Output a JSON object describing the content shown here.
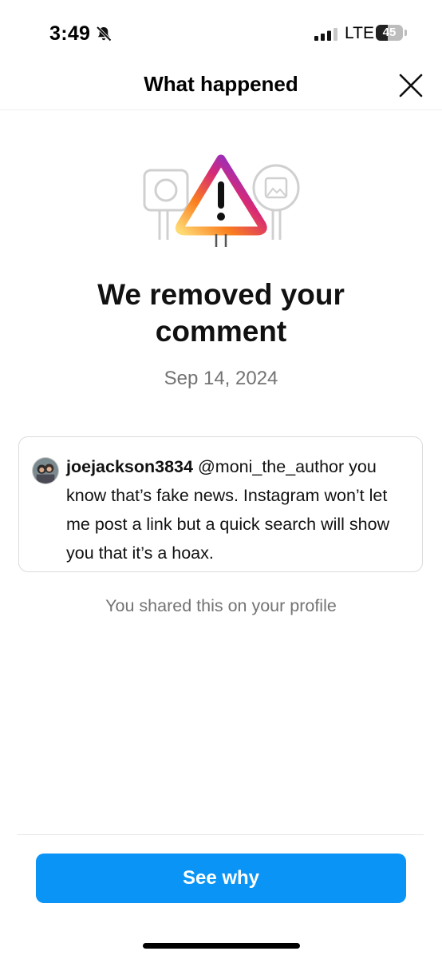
{
  "status_bar": {
    "time": "3:49",
    "network": "LTE",
    "battery_level": "45",
    "icons": [
      "bell-slash-icon",
      "cellular-signal-icon",
      "battery-icon"
    ]
  },
  "header": {
    "title": "What happened",
    "close_icon": "close-icon"
  },
  "illustration": {
    "icon": "warning-triangle-icon",
    "gradient_colors": [
      "#feda75",
      "#fa7e1e",
      "#d62976",
      "#962fbf",
      "#4f5bd5"
    ]
  },
  "main": {
    "headline": "We removed your comment",
    "date": "Sep 14, 2024"
  },
  "comment": {
    "username": "joejackson3834",
    "text": "@moni_the_author you know that’s fake news. Instagram won’t let me post a link but a quick search will show you that it’s a hoax.",
    "avatar": "avatar-photo"
  },
  "shared_note": "You shared this on your profile",
  "actions": {
    "see_why_label": "See why",
    "button_color": "#0a95f6"
  }
}
